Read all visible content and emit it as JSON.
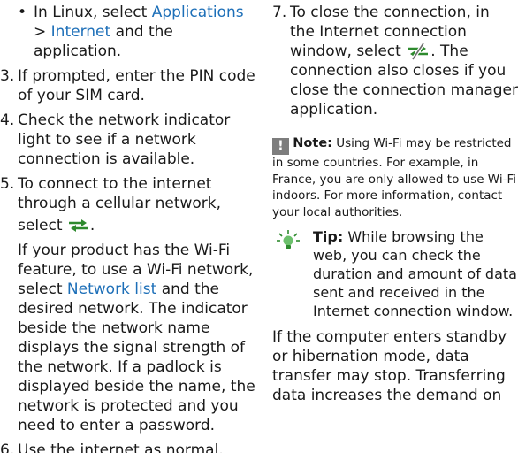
{
  "left": {
    "bullet": {
      "prefix": "In Linux, select",
      "link1": "Applications",
      "separator": ">",
      "link2": "Internet",
      "suffix": "and the application."
    },
    "step3": {
      "num": "3.",
      "text": "If prompted, enter the PIN code of your SIM card."
    },
    "step4": {
      "num": "4.",
      "text": "Check the network indicator light to see if a network connection is available."
    },
    "step5": {
      "num": "5.",
      "text": "To connect to the internet through a cellular network,",
      "select_word": "select",
      "after_icon": ".",
      "para_text_1": "If your product has the Wi-Fi feature, to use a Wi-Fi network, select",
      "para_link": "Network list",
      "para_text_2": "and the desired network. The indicator beside the network name displays the signal strength of the network. If a padlock is displayed beside the name, the network is protected and you need to enter a password."
    },
    "step6": {
      "num": "6.",
      "text": "Use the internet as normal."
    }
  },
  "right": {
    "step7": {
      "num": "7.",
      "text_before": "To close the connection, in the Internet connection window,",
      "select_word": "select",
      "text_after": ". The connection also closes if you close the connection manager application."
    },
    "note": {
      "icon_glyph": "!",
      "label": "Note:",
      "text": "Using Wi-Fi may be restricted in some countries. For example, in France, you are only allowed to use Wi-Fi indoors. For more information, contact your local authorities."
    },
    "tip": {
      "label": "Tip:",
      "text": "While browsing the web, you can check the duration and amount of data sent and received in the Internet connection window."
    },
    "paragraph": "If the computer enters standby or hibernation mode, data transfer may stop. Transferring data increases the demand on"
  },
  "colors": {
    "link": "#1d6fb8",
    "text": "#1a1a1a",
    "note_icon_bg": "#7d7d7d",
    "icon_green": "#2e8a2e"
  }
}
